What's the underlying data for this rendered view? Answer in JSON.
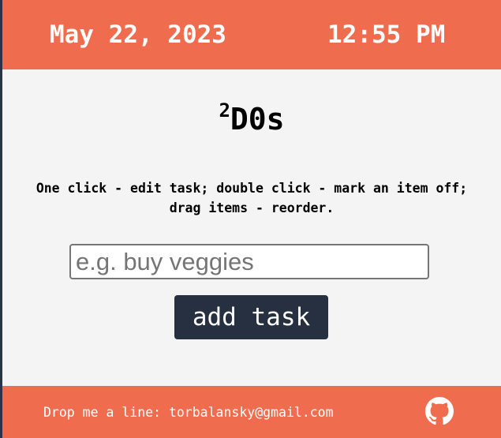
{
  "header": {
    "date": "May 22, 2023",
    "time": "12:55 PM"
  },
  "main": {
    "title_sup": "2",
    "title_main": "D0s",
    "instructions": "One click - edit task; double click - mark an item off; drag items - reorder.",
    "input_placeholder": "e.g. buy veggies",
    "input_value": "",
    "add_button_label": "add task"
  },
  "footer": {
    "contact_text": "Drop me a line: torbalansky@gmail.com",
    "icon": "github-icon"
  },
  "colors": {
    "accent": "#ef6c4f",
    "button": "#263040",
    "background": "#f4f4f4",
    "outer": "#2b3442"
  }
}
